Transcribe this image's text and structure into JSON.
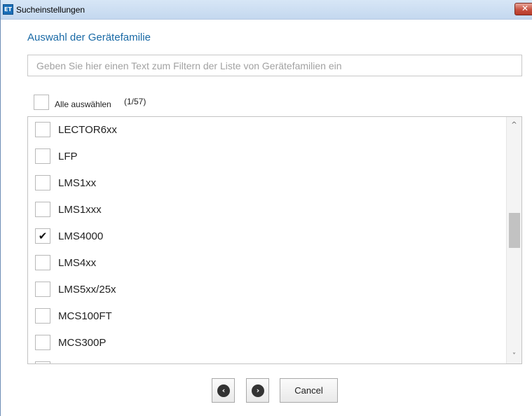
{
  "window": {
    "title": "Sucheinstellungen",
    "app_icon_text": "ET",
    "close_glyph": "✕"
  },
  "main": {
    "section_title": "Auswahl der Gerätefamilie",
    "filter": {
      "value": "",
      "placeholder": "Geben Sie hier einen Text zum Filtern der Liste von Gerätefamilien ein"
    },
    "select_all": {
      "label": "Alle auswählen",
      "count": "(1/57)",
      "checked": false
    },
    "items": [
      {
        "label": "LECTOR6xx",
        "checked": false
      },
      {
        "label": "LFP",
        "checked": false
      },
      {
        "label": "LMS1xx",
        "checked": false
      },
      {
        "label": "LMS1xxx",
        "checked": false
      },
      {
        "label": "LMS4000",
        "checked": true
      },
      {
        "label": "LMS4xx",
        "checked": false
      },
      {
        "label": "LMS5xx/25x",
        "checked": false
      },
      {
        "label": "MCS100FT",
        "checked": false
      },
      {
        "label": "MCS300P",
        "checked": false
      }
    ],
    "check_glyph": "✔",
    "scrollbar": {
      "up_glyph": "^",
      "down_glyph": "˅"
    }
  },
  "footer": {
    "back_glyph": "‹",
    "next_glyph": "›",
    "cancel_label": "Cancel"
  },
  "icons": [
    "app-icon",
    "close-icon",
    "checkmark-icon",
    "chevron-left-icon",
    "chevron-right-icon",
    "scroll-up-icon",
    "scroll-down-icon"
  ]
}
